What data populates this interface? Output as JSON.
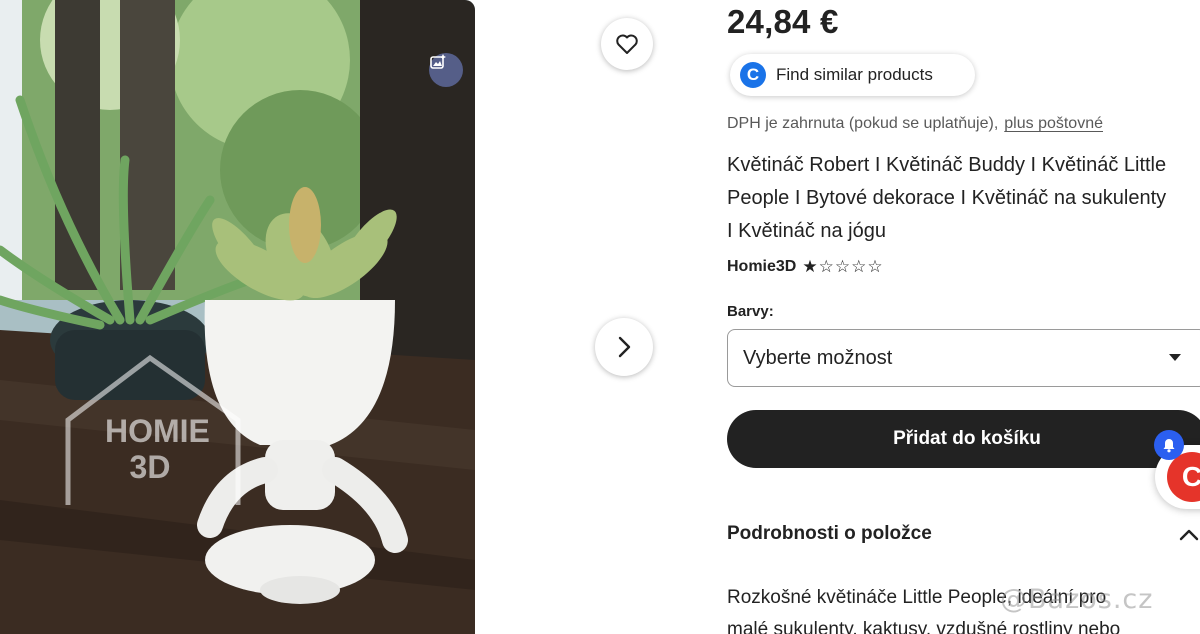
{
  "product": {
    "price": "24,84 €",
    "find_similar_label": "Find similar products",
    "vat_note": "DPH je zahrnuta (pokud se uplatňuje),",
    "postage_link": "plus poštovné",
    "title_lines": [
      "Květináč Robert I Květináč Buddy I Květináč Little",
      "People I Bytové dekorace I Květináč na sukulenty",
      "I Květináč na jógu"
    ],
    "shop_name": "Homie3D",
    "rating": {
      "value": 1,
      "max": 5
    },
    "variant_label": "Barvy:",
    "variant_select_value": "Vyberte možnost",
    "add_to_cart_label": "Přidat do košíku",
    "details_header": "Podrobnosti o položce",
    "description_lines": [
      "Rozkošné květináče Little People, ideální pro",
      "malé sukulenty, kaktusy, vzdušné rostliny nebo"
    ]
  },
  "photo": {
    "logo_lines": [
      "HOMIE",
      "3D"
    ]
  },
  "overlay": {
    "watermark": "@Bazos.cz",
    "app_badge_letter": "C"
  },
  "icons": {
    "favorite": "heart-icon",
    "next": "chevron-right-icon",
    "similar": "search-logo-icon",
    "photo_action": "image-sparkle-icon",
    "select_caret": "caret-down-icon",
    "details_toggle": "chevron-up-icon",
    "notification": "bell-icon"
  },
  "colors": {
    "primary_button": "#222222",
    "similar_logo": "#1a73e8",
    "notification": "#2b5ff0",
    "app_badge": "#e5342a"
  }
}
